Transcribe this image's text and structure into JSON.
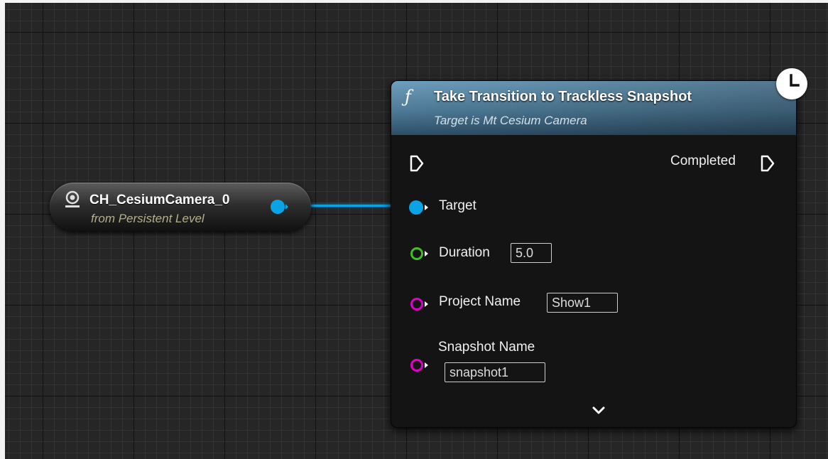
{
  "variable_node": {
    "title": "CH_CesiumCamera_0",
    "subtitle": "from Persistent Level",
    "icon": "camera-actor-icon"
  },
  "function_node": {
    "icon": "ƒ",
    "title": "Take Transition to Trackless Snapshot",
    "subtitle": "Target is Mt Cesium Camera",
    "latent_icon": "clock-icon",
    "outputs": {
      "completed_label": "Completed"
    },
    "inputs": {
      "target_label": "Target",
      "duration_label": "Duration",
      "duration_value": "5.0",
      "project_label": "Project Name",
      "project_value": "Show1",
      "snapshot_label": "Snapshot Name",
      "snapshot_value": "snapshot1"
    },
    "expand_icon": "chevron-down-icon"
  },
  "colors": {
    "object_pin": "#0aa3e6",
    "float_pin": "#40c020",
    "string_pin": "#e000c8",
    "header": "#4e7a97"
  }
}
